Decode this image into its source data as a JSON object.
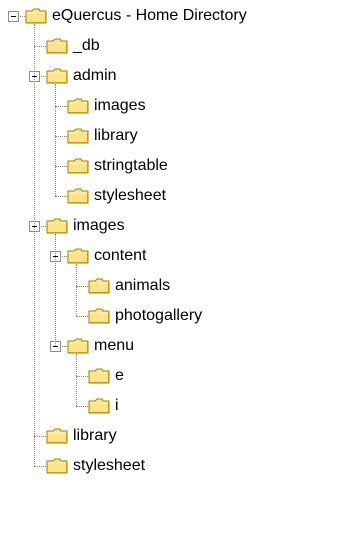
{
  "tree": {
    "root": {
      "label": "eQuercus - Home Directory",
      "expanded": true,
      "children": [
        {
          "label": "_db"
        },
        {
          "label": "admin",
          "expanded": true,
          "children": [
            {
              "label": "images"
            },
            {
              "label": "library"
            },
            {
              "label": "stringtable"
            },
            {
              "label": "stylesheet"
            }
          ]
        },
        {
          "label": "images",
          "expanded": true,
          "children": [
            {
              "label": "content",
              "expanded": true,
              "children": [
                {
                  "label": "animals"
                },
                {
                  "label": "photogallery"
                }
              ]
            },
            {
              "label": "menu",
              "expanded": true,
              "children": [
                {
                  "label": "e"
                },
                {
                  "label": "i"
                }
              ]
            }
          ]
        },
        {
          "label": "library"
        },
        {
          "label": "stylesheet"
        }
      ]
    }
  },
  "colors": {
    "folder_fill": "#ffe38a",
    "folder_edge": "#a08000",
    "connector": "#8a8a8a"
  },
  "icons": {
    "folder": "folder-icon",
    "collapse": "minus-box-icon"
  }
}
